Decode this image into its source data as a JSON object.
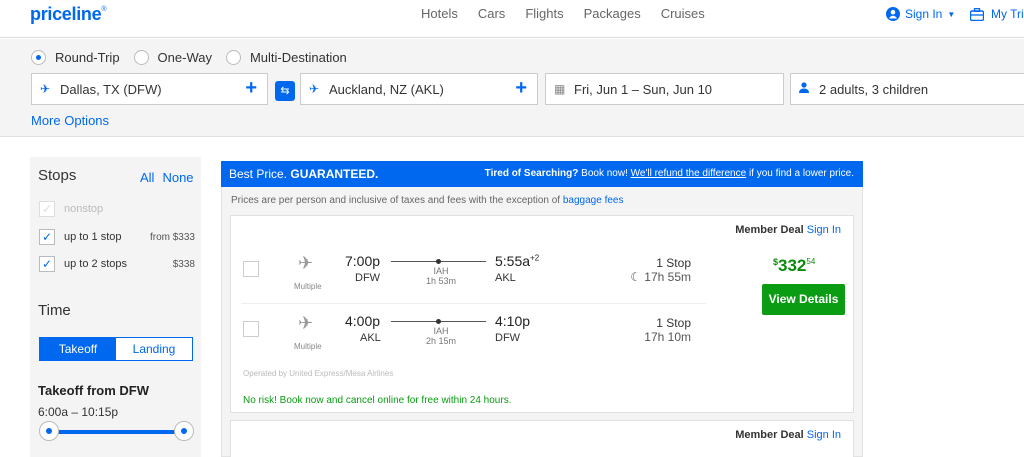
{
  "header": {
    "logo": "priceline",
    "logo_mark": "®",
    "nav": [
      "Hotels",
      "Cars",
      "Flights",
      "Packages",
      "Cruises"
    ],
    "sign_in": "Sign In",
    "my_trips": "My Tri"
  },
  "search": {
    "trip_types": [
      "Round-Trip",
      "One-Way",
      "Multi-Destination"
    ],
    "selected_trip": "Round-Trip",
    "origin": "Dallas, TX (DFW)",
    "destination": "Auckland, NZ (AKL)",
    "dates": "Fri, Jun 1 – Sun, Jun 10",
    "travelers": "2 adults, 3 children",
    "more_options": "More Options"
  },
  "filters": {
    "stops_title": "Stops",
    "all": "All",
    "none": "None",
    "stop_options": [
      {
        "label": "nonstop",
        "price": "",
        "checked": true,
        "disabled": true
      },
      {
        "label": "up to 1 stop",
        "price": "from $333",
        "checked": true,
        "disabled": false
      },
      {
        "label": "up to 2 stops",
        "price": "$338",
        "checked": true,
        "disabled": false
      }
    ],
    "time_title": "Time",
    "takeoff_tab": "Takeoff",
    "landing_tab": "Landing",
    "takeoff_from": "Takeoff from DFW",
    "time_range": "6:00a – 10:15p"
  },
  "results": {
    "banner_left_normal": "Best Price.",
    "banner_left_bold": "GUARANTEED.",
    "banner_right_bold": "Tired of Searching?",
    "banner_right_normal": "Book now!",
    "banner_right_link": "We'll refund the difference",
    "banner_right_tail": "if you find a lower price.",
    "disclaimer": "Prices are per person and inclusive of taxes and fees with the exception of",
    "disclaimer_link": "baggage fees",
    "member_deal": "Member Deal",
    "member_signin": "Sign In",
    "card1": {
      "outbound": {
        "airline": "Multiple",
        "depart_time": "7:00p",
        "depart_code": "DFW",
        "arrive_time": "5:55a",
        "arrive_plus": "+2",
        "arrive_code": "AKL",
        "via": "IAH",
        "layover": "1h 53m",
        "stops": "1 Stop",
        "duration": "17h 55m"
      },
      "inbound": {
        "airline": "Multiple",
        "depart_time": "4:00p",
        "depart_code": "AKL",
        "arrive_time": "4:10p",
        "arrive_code": "DFW",
        "via": "IAH",
        "layover": "2h 15m",
        "stops": "1 Stop",
        "duration": "17h 10m"
      },
      "price_dollar": "$",
      "price_main": "332",
      "price_cents": "54",
      "view_details": "View Details",
      "operated_by": "Operated by United Express/Mesa Airlines",
      "no_risk": "No risk! Book now and cancel online for free within 24 hours."
    }
  },
  "colors": {
    "brand": "#0068ef",
    "green": "#0a9c12"
  }
}
